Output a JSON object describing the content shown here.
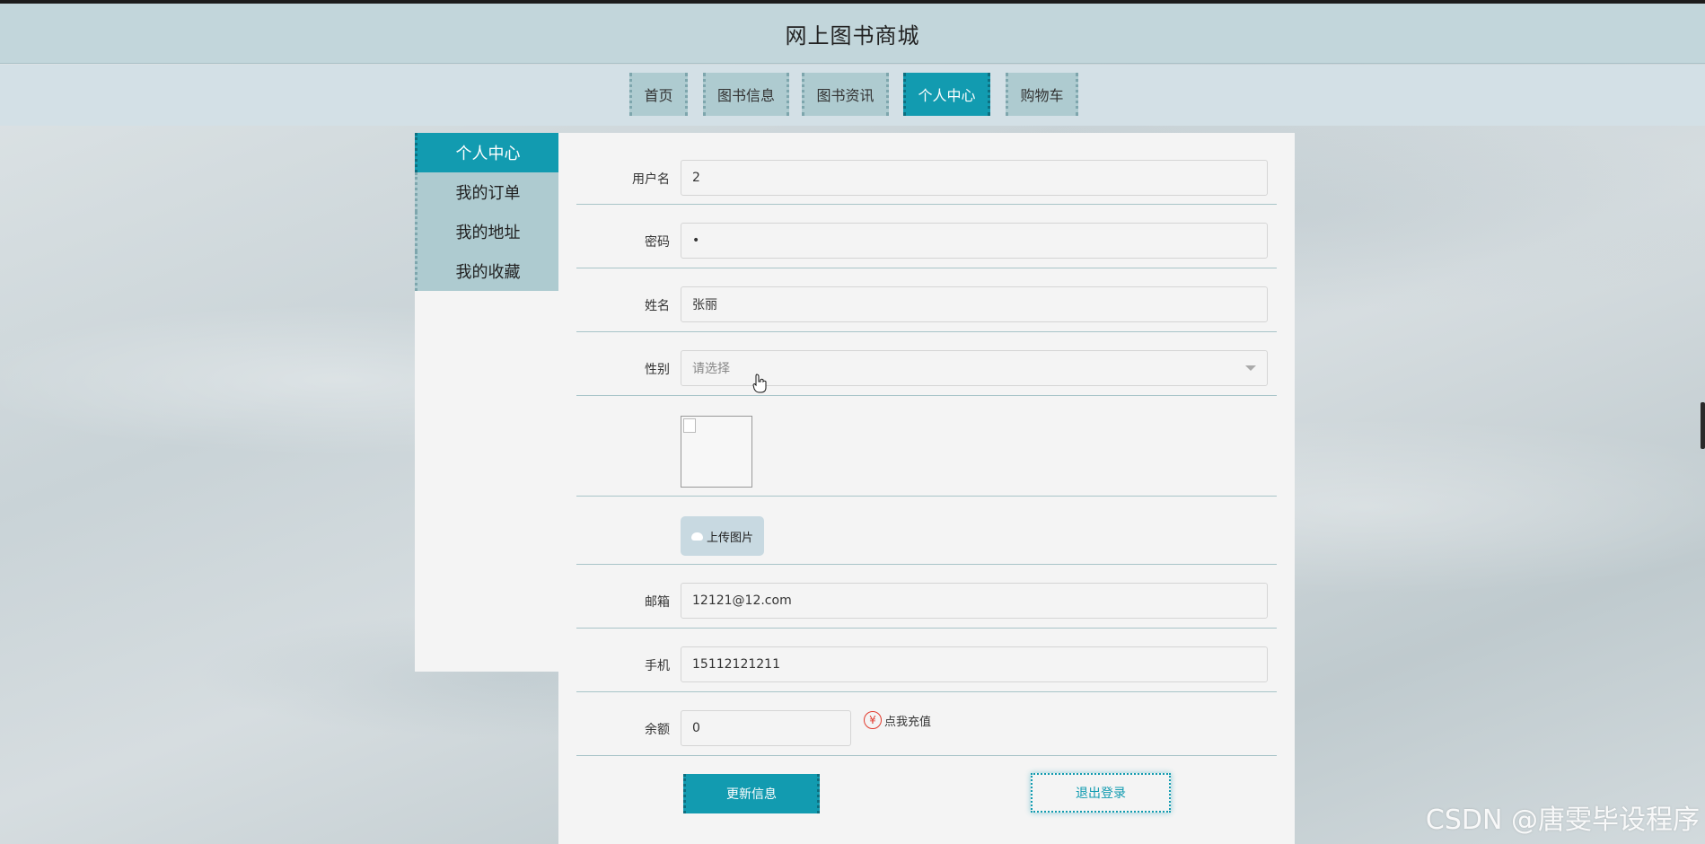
{
  "header": {
    "title": "网上图书商城"
  },
  "nav": {
    "items": [
      {
        "label": "首页"
      },
      {
        "label": "图书信息"
      },
      {
        "label": "图书资讯"
      },
      {
        "label": "个人中心"
      },
      {
        "label": "购物车"
      }
    ],
    "active": "个人中心"
  },
  "sidebar": {
    "items": [
      {
        "label": "个人中心"
      },
      {
        "label": "我的订单"
      },
      {
        "label": "我的地址"
      },
      {
        "label": "我的收藏"
      }
    ],
    "active": "个人中心"
  },
  "form": {
    "username": {
      "label": "用户名",
      "value": "2"
    },
    "password": {
      "label": "密码",
      "value": "•"
    },
    "name": {
      "label": "姓名",
      "value": "张丽"
    },
    "gender": {
      "label": "性别",
      "placeholder": "请选择"
    },
    "upload_label": "上传图片",
    "email": {
      "label": "邮箱",
      "value": "12121@12.com"
    },
    "phone": {
      "label": "手机",
      "value": "15112121211"
    },
    "balance": {
      "label": "余额",
      "value": "0",
      "recharge_label": "点我充值",
      "recharge_icon": "¥"
    }
  },
  "actions": {
    "update_label": "更新信息",
    "logout_label": "退出登录"
  },
  "watermark": "CSDN @唐雯毕设程序",
  "colors": {
    "accent": "#129bb0",
    "nav_bg": "#aecbd0",
    "header_bg": "#c2d6db"
  }
}
